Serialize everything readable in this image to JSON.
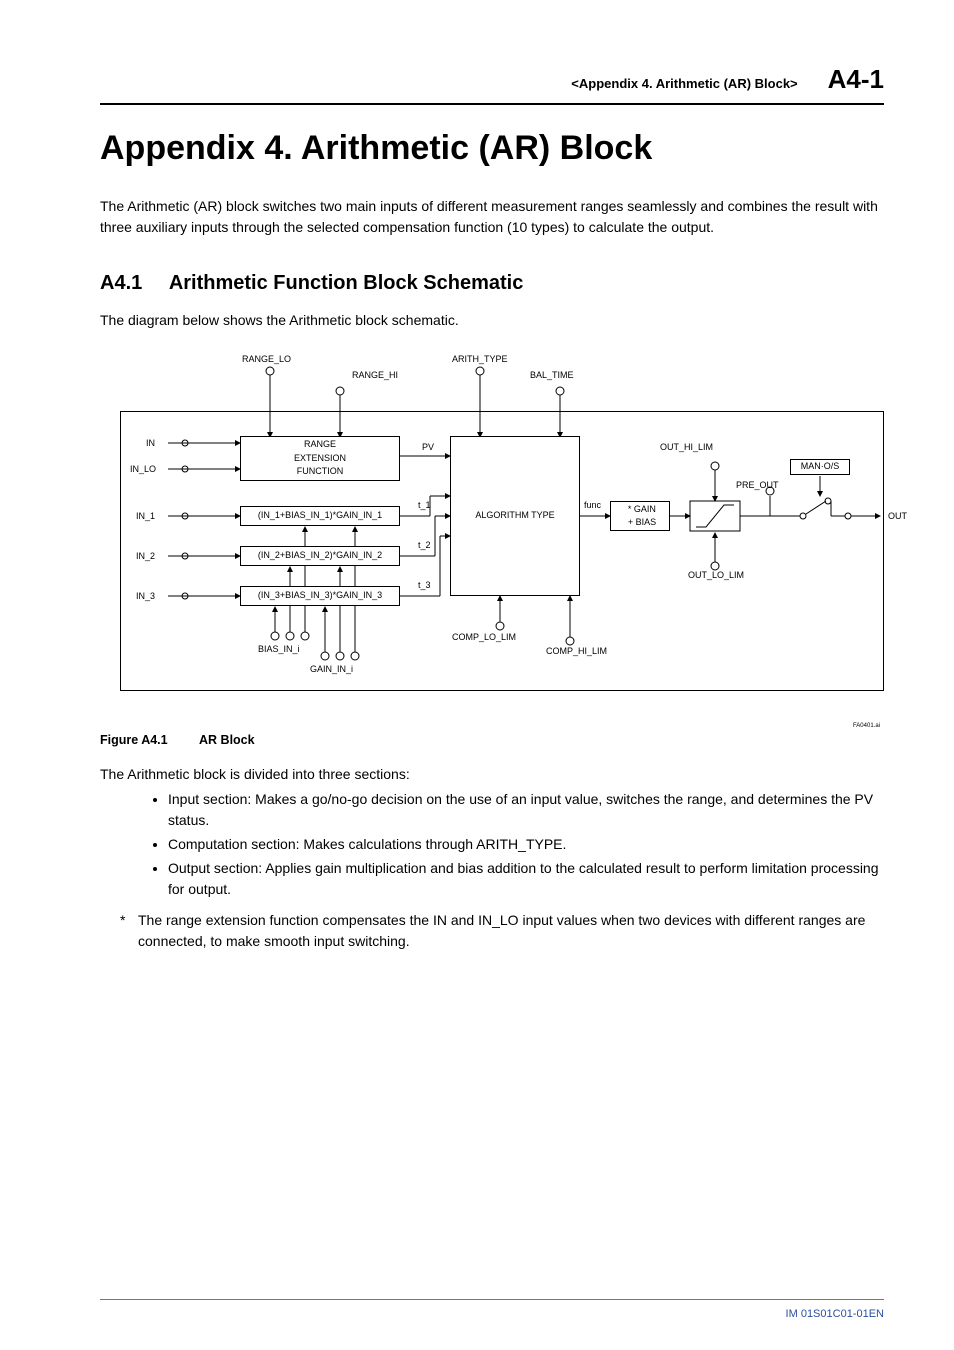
{
  "header": {
    "section_label": "<Appendix 4.  Arithmetic (AR) Block>",
    "page_number": "A4-1"
  },
  "title": "Appendix 4.  Arithmetic (AR) Block",
  "intro": "The Arithmetic (AR) block switches two main inputs of different measurement ranges seamlessly and combines the result with three auxiliary inputs through the selected compensation function (10 types) to calculate the output.",
  "section": {
    "number": "A4.1",
    "title": "Arithmetic Function Block Schematic",
    "caption": "The diagram below shows the Arithmetic block schematic."
  },
  "diagram": {
    "top_params": {
      "range_lo": "RANGE_LO",
      "range_hi": "RANGE_HI",
      "arith_type": "ARITH_TYPE",
      "bal_time": "BAL_TIME"
    },
    "inputs": {
      "in": "IN",
      "in_lo": "IN_LO",
      "in_1": "IN_1",
      "in_2": "IN_2",
      "in_3": "IN_3"
    },
    "blocks": {
      "range_ext": "RANGE\nEXTENSION\nFUNCTION",
      "calc1": "(IN_1+BIAS_IN_1)*GAIN_IN_1",
      "calc2": "(IN_2+BIAS_IN_2)*GAIN_IN_2",
      "calc3": "(IN_3+BIAS_IN_3)*GAIN_IN_3",
      "alg_type": "ALGORITHM TYPE",
      "gain_bias": "* GAIN\n+ BIAS",
      "man_os": "MAN·O/S"
    },
    "mid_labels": {
      "pv": "PV",
      "t1": "t_1",
      "t2": "t_2",
      "t3": "t_3",
      "func": "func"
    },
    "limits": {
      "out_hi_lim": "OUT_HI_LIM",
      "out_lo_lim": "OUT_LO_LIM",
      "pre_out": "PRE_OUT",
      "comp_lo_lim": "COMP_LO_LIM",
      "comp_hi_lim": "COMP_HI_LIM",
      "bias_in_i": "BIAS_IN_i",
      "gain_in_i": "GAIN_IN_i"
    },
    "output": "OUT",
    "credit": "FA0401.ai"
  },
  "figure": {
    "number": "Figure A4.1",
    "title": "AR Block"
  },
  "body": {
    "sections_intro": "The Arithmetic block is divided into three sections:",
    "bullets": [
      "Input section: Makes a go/no-go decision on the use of an input value, switches the range, and determines the PV status.",
      "Computation section: Makes calculations through ARITH_TYPE.",
      "Output section: Applies gain multiplication and bias addition to the calculated result to perform limitation processing for output."
    ],
    "footnote": "The range extension function compensates the IN and IN_LO input values when two devices with different ranges are connected, to make smooth input switching."
  },
  "footer": {
    "doc_id": "IM 01S01C01-01EN"
  }
}
